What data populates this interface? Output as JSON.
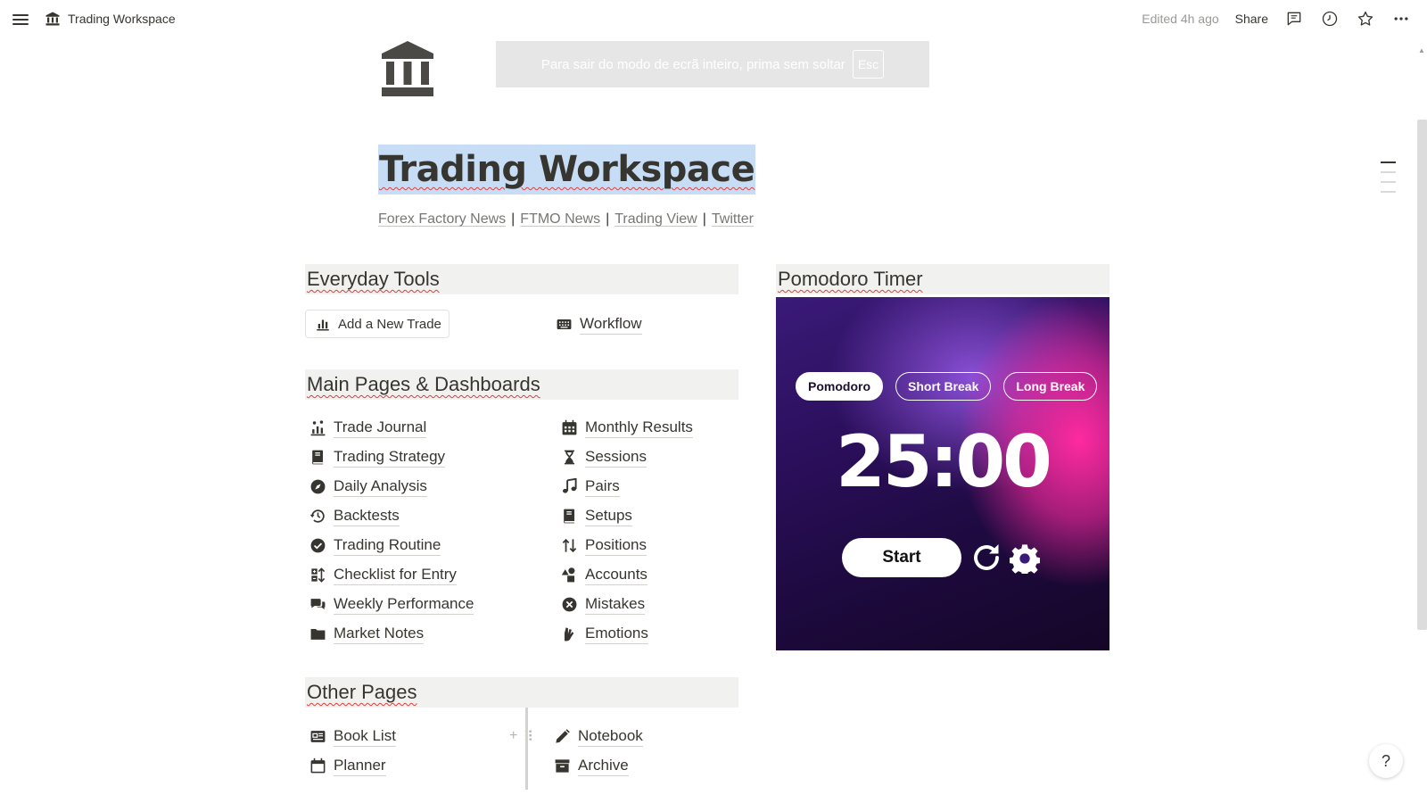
{
  "topbar": {
    "page_name": "Trading Workspace",
    "edited": "Edited 4h ago",
    "share": "Share"
  },
  "fullscreen_notice": {
    "text": "Para sair do modo de ecrã inteiro, prima sem soltar",
    "key": "Esc"
  },
  "page": {
    "title": "Trading Workspace",
    "links": [
      "Forex Factory News",
      "FTMO News",
      "Trading View",
      "Twitter"
    ],
    "separator": "|"
  },
  "everyday_tools": {
    "heading": "Everyday Tools",
    "add_button": "Add a New Trade",
    "workflow": "Workflow"
  },
  "main_pages": {
    "heading": "Main Pages & Dashboards",
    "left": [
      {
        "label": "Trade Journal",
        "icon": "chart-people-icon"
      },
      {
        "label": "Trading Strategy",
        "icon": "book-icon"
      },
      {
        "label": "Daily Analysis",
        "icon": "compass-icon"
      },
      {
        "label": "Backtests",
        "icon": "history-icon"
      },
      {
        "label": "Trading Routine",
        "icon": "check-circle-icon"
      },
      {
        "label": "Checklist for Entry",
        "icon": "sort-icon"
      },
      {
        "label": "Weekly Performance",
        "icon": "comments-icon"
      },
      {
        "label": "Market Notes",
        "icon": "folder-icon"
      }
    ],
    "right": [
      {
        "label": "Monthly Results",
        "icon": "calendar-grid-icon"
      },
      {
        "label": "Sessions",
        "icon": "hourglass-icon"
      },
      {
        "label": "Pairs",
        "icon": "music-note-icon"
      },
      {
        "label": "Setups",
        "icon": "book-icon"
      },
      {
        "label": "Positions",
        "icon": "arrows-updown-icon"
      },
      {
        "label": "Accounts",
        "icon": "shapes-icon"
      },
      {
        "label": "Mistakes",
        "icon": "x-circle-icon"
      },
      {
        "label": "Emotions",
        "icon": "hand-icon"
      }
    ]
  },
  "other_pages": {
    "heading": "Other Pages",
    "left": [
      {
        "label": "Book List",
        "icon": "newspaper-icon"
      },
      {
        "label": "Planner",
        "icon": "calendar-icon"
      }
    ],
    "right": [
      {
        "label": "Notebook",
        "icon": "pencil-icon"
      },
      {
        "label": "Archive",
        "icon": "archive-icon"
      }
    ]
  },
  "pomodoro": {
    "heading": "Pomodoro Timer",
    "tabs": [
      "Pomodoro",
      "Short Break",
      "Long Break"
    ],
    "active_tab": "Pomodoro",
    "time": "25:00",
    "start": "Start",
    "colors": {
      "accent": "#ff2aa0",
      "bg": "#2b0f5c"
    }
  },
  "help": {
    "glyph": "?"
  }
}
